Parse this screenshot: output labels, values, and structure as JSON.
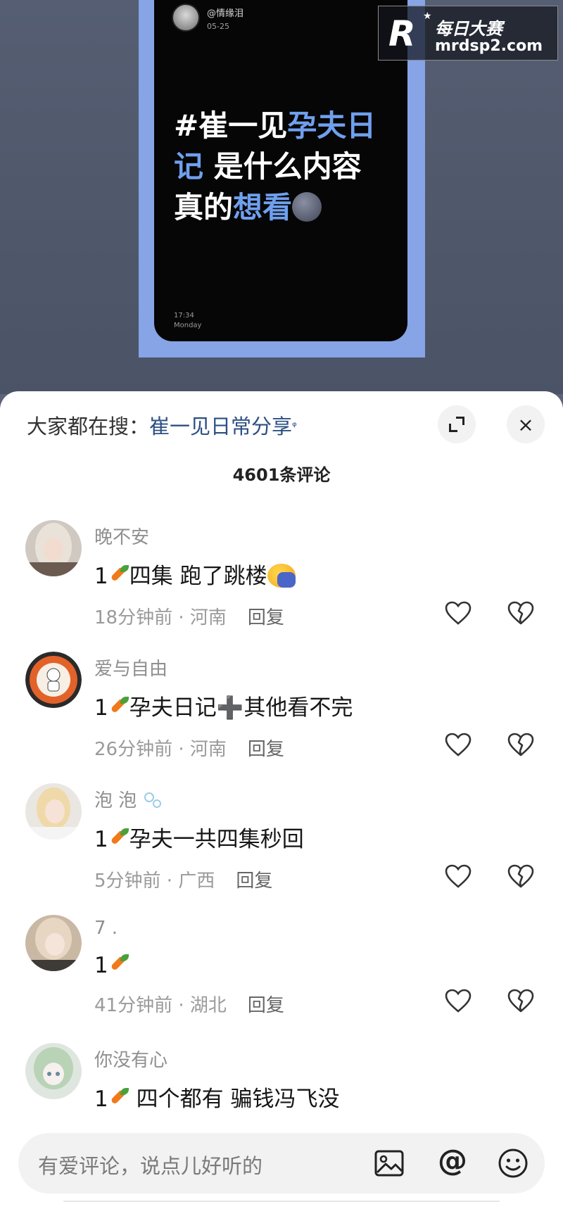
{
  "video": {
    "username": "@情缘泪",
    "date": "05-25",
    "headline_parts": [
      "#崔一见",
      "孕夫日记",
      " 是什么内容 真的",
      "想看"
    ],
    "time": "17:34",
    "day": "Monday"
  },
  "watermark": {
    "logo_letter": "R",
    "title": "每日大赛",
    "url": "mrdsp2.com"
  },
  "sheet": {
    "search_prefix": "大家都在搜：",
    "search_term": "崔一见日常分享",
    "search_icon": "search-icon",
    "expand_icon": "expand-icon",
    "close_icon": "×",
    "comment_count": "4601条评论"
  },
  "comments": [
    {
      "name": "晚不安",
      "text_prefix": "1",
      "text_body": "四集 跑了跳楼",
      "time": "18分钟前 · 河南",
      "reply": "回复"
    },
    {
      "name": "爱与自由",
      "text_prefix": "1",
      "text_body": "孕夫日记",
      "text_suffix": "其他看不完",
      "time": "26分钟前 · 河南",
      "reply": "回复"
    },
    {
      "name": "泡 泡",
      "text_prefix": "1",
      "text_body": "孕夫一共四集秒回",
      "time": "5分钟前 · 广西",
      "reply": "回复"
    },
    {
      "name": "7 .",
      "text_prefix": "1",
      "text_body": "",
      "time": "41分钟前 · 湖北",
      "reply": "回复"
    },
    {
      "name": "你没有心",
      "text_prefix": "1",
      "text_body": " 四个都有 骗钱冯飞没"
    }
  ],
  "input": {
    "placeholder": "有爱评论，说点儿好听的",
    "at_symbol": "@"
  },
  "colors": {
    "accent_blue": "#6fa0ee",
    "search_link": "#2d4f82",
    "carrot": "#f07a1a"
  }
}
